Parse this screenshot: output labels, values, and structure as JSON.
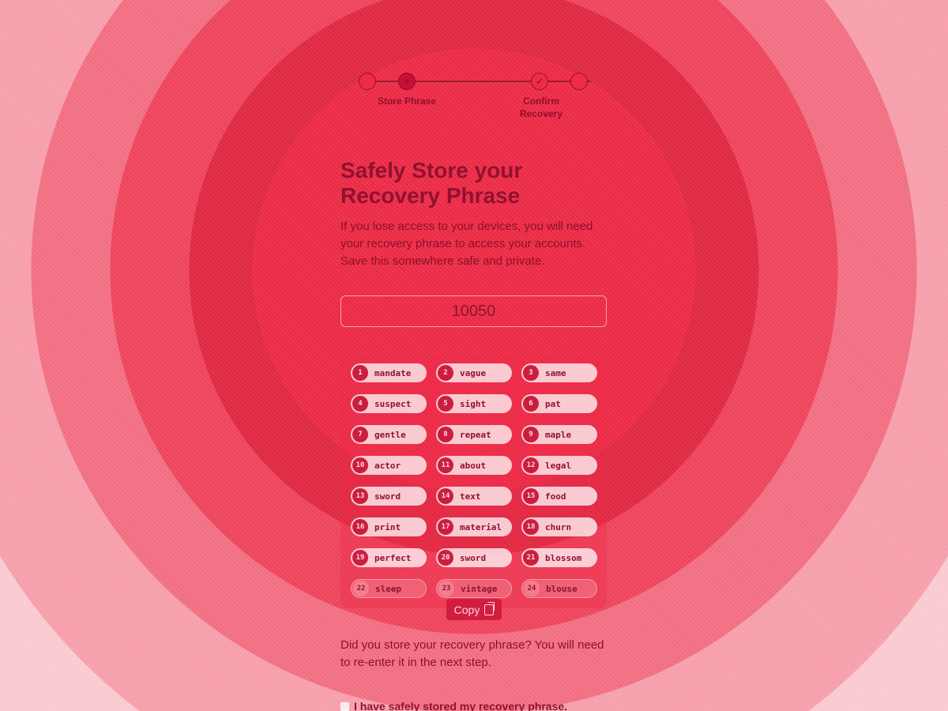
{
  "stepper": {
    "steps": [
      {
        "label": "",
        "state": "complete"
      },
      {
        "label": "Store Phrase",
        "state": "current",
        "icon": "current-step-icon"
      },
      {
        "label": "Confirm Recovery",
        "state": "upcoming",
        "icon": "check-icon"
      },
      {
        "label": "",
        "state": "upcoming"
      }
    ]
  },
  "title": "Safely Store your Recovery Phrase",
  "description": "If you lose access to your devices, you will need your recovery phrase to access your accounts. Save this somewhere safe and private.",
  "code": "10050",
  "words": [
    {
      "num": "1",
      "word": "mandate"
    },
    {
      "num": "2",
      "word": "vague"
    },
    {
      "num": "3",
      "word": "same"
    },
    {
      "num": "4",
      "word": "suspect"
    },
    {
      "num": "5",
      "word": "sight"
    },
    {
      "num": "6",
      "word": "pat"
    },
    {
      "num": "7",
      "word": "gentle"
    },
    {
      "num": "8",
      "word": "repeat"
    },
    {
      "num": "9",
      "word": "maple"
    },
    {
      "num": "10",
      "word": "actor"
    },
    {
      "num": "11",
      "word": "about"
    },
    {
      "num": "12",
      "word": "legal"
    },
    {
      "num": "13",
      "word": "sword"
    },
    {
      "num": "14",
      "word": "text"
    },
    {
      "num": "15",
      "word": "food"
    },
    {
      "num": "16",
      "word": "print"
    },
    {
      "num": "17",
      "word": "material"
    },
    {
      "num": "18",
      "word": "churn"
    },
    {
      "num": "19",
      "word": "perfect"
    },
    {
      "num": "20",
      "word": "sword"
    },
    {
      "num": "21",
      "word": "blossom"
    },
    {
      "num": "22",
      "word": "sleep"
    },
    {
      "num": "23",
      "word": "vintage"
    },
    {
      "num": "24",
      "word": "blouse"
    }
  ],
  "copy_button": {
    "label": "Copy",
    "icon": "copy-icon"
  },
  "question": "Did you store your recovery phrase? You will need to re-enter it in the next step.",
  "checkbox": {
    "label": "I have safely stored my recovery phrase.",
    "checked": false
  },
  "colors": {
    "background": "#ef2b47",
    "accent": "#c90f37",
    "text": "#8f1230"
  }
}
